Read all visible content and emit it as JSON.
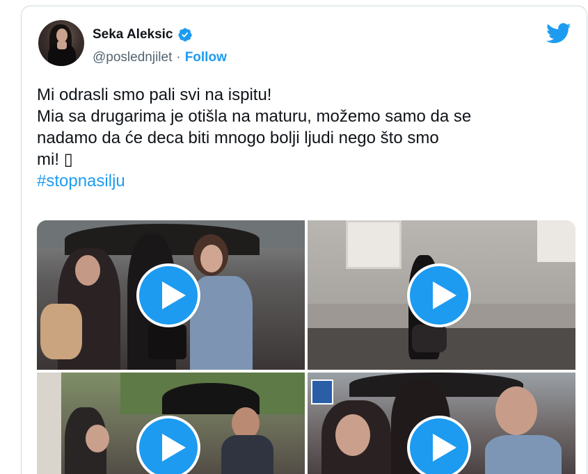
{
  "author": {
    "name": "Seka Aleksic",
    "handle": "@poslednjilet",
    "separator": "·",
    "follow_label": "Follow"
  },
  "tweet": {
    "line1": "Mi odrasli smo pali svi na ispitu!",
    "line2": "Mia sa drugarima je otišla na maturu, možemo samo da se",
    "line3": "nadamo da će deca biti mnogo bolji ljudi nego što smo",
    "line4": "mi! ▯",
    "hashtag": "#stopnasilju"
  },
  "media": [
    {
      "type": "video",
      "icon": "play-icon"
    },
    {
      "type": "video",
      "icon": "play-icon"
    },
    {
      "type": "video",
      "icon": "play-icon"
    },
    {
      "type": "video",
      "icon": "play-icon"
    }
  ],
  "colors": {
    "accent": "#1d9bf0",
    "text": "#0f1419",
    "secondary": "#536471",
    "border": "#cfd9de"
  }
}
